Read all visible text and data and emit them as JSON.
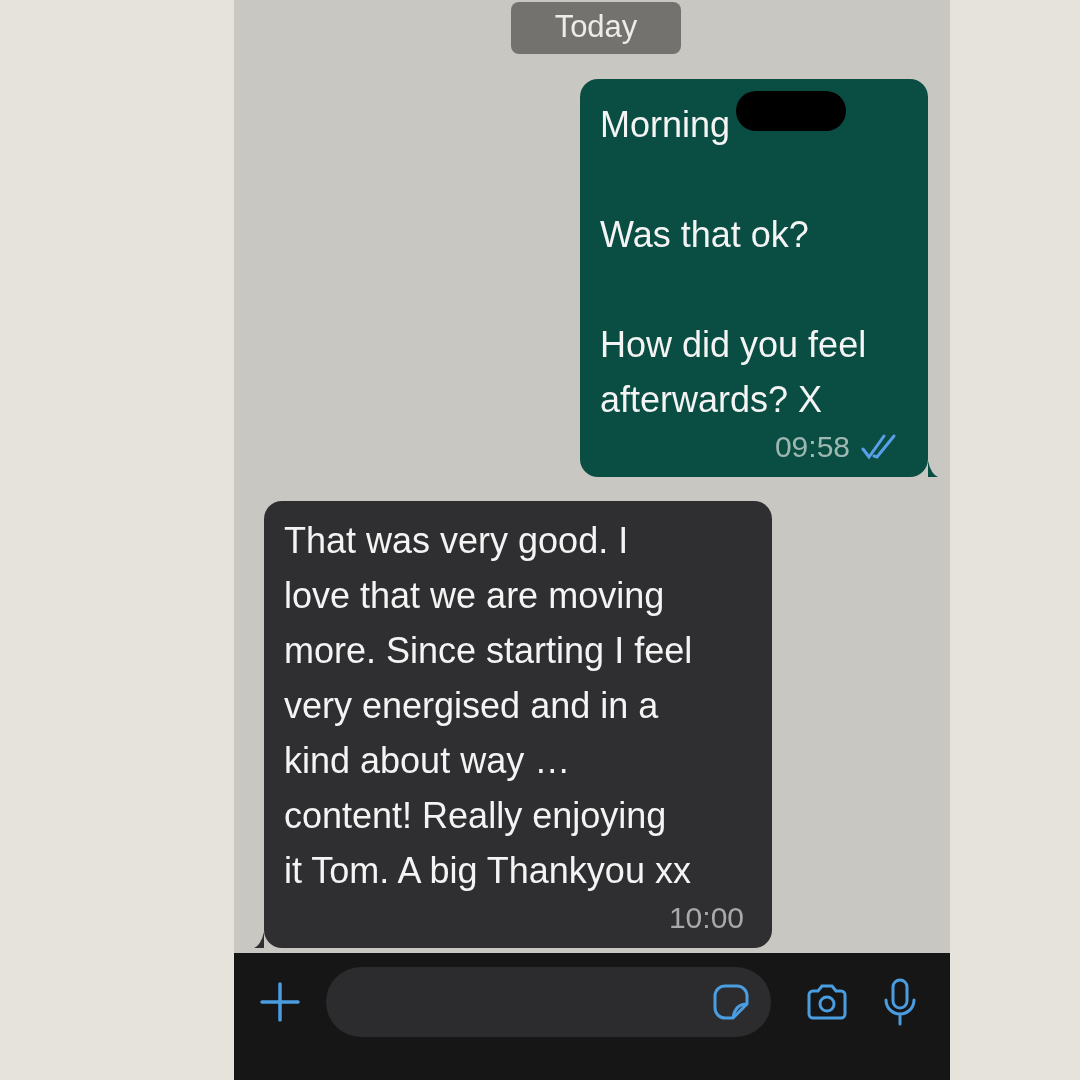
{
  "date_divider": "Today",
  "messages": [
    {
      "kind": "outgoing",
      "paragraphs": [
        "Morning",
        "Was that ok?",
        "How did you feel\nafterwards? X"
      ],
      "redacted_after_first": true,
      "time": "09:58",
      "read": true
    },
    {
      "kind": "incoming",
      "paragraphs": [
        "That was very good. I\nlove that we are moving\nmore. Since starting I feel\nvery energised and  in a\nkind about way …\ncontent! Really enjoying\nit Tom. A big Thankyou xx"
      ],
      "time": "10:00"
    }
  ]
}
